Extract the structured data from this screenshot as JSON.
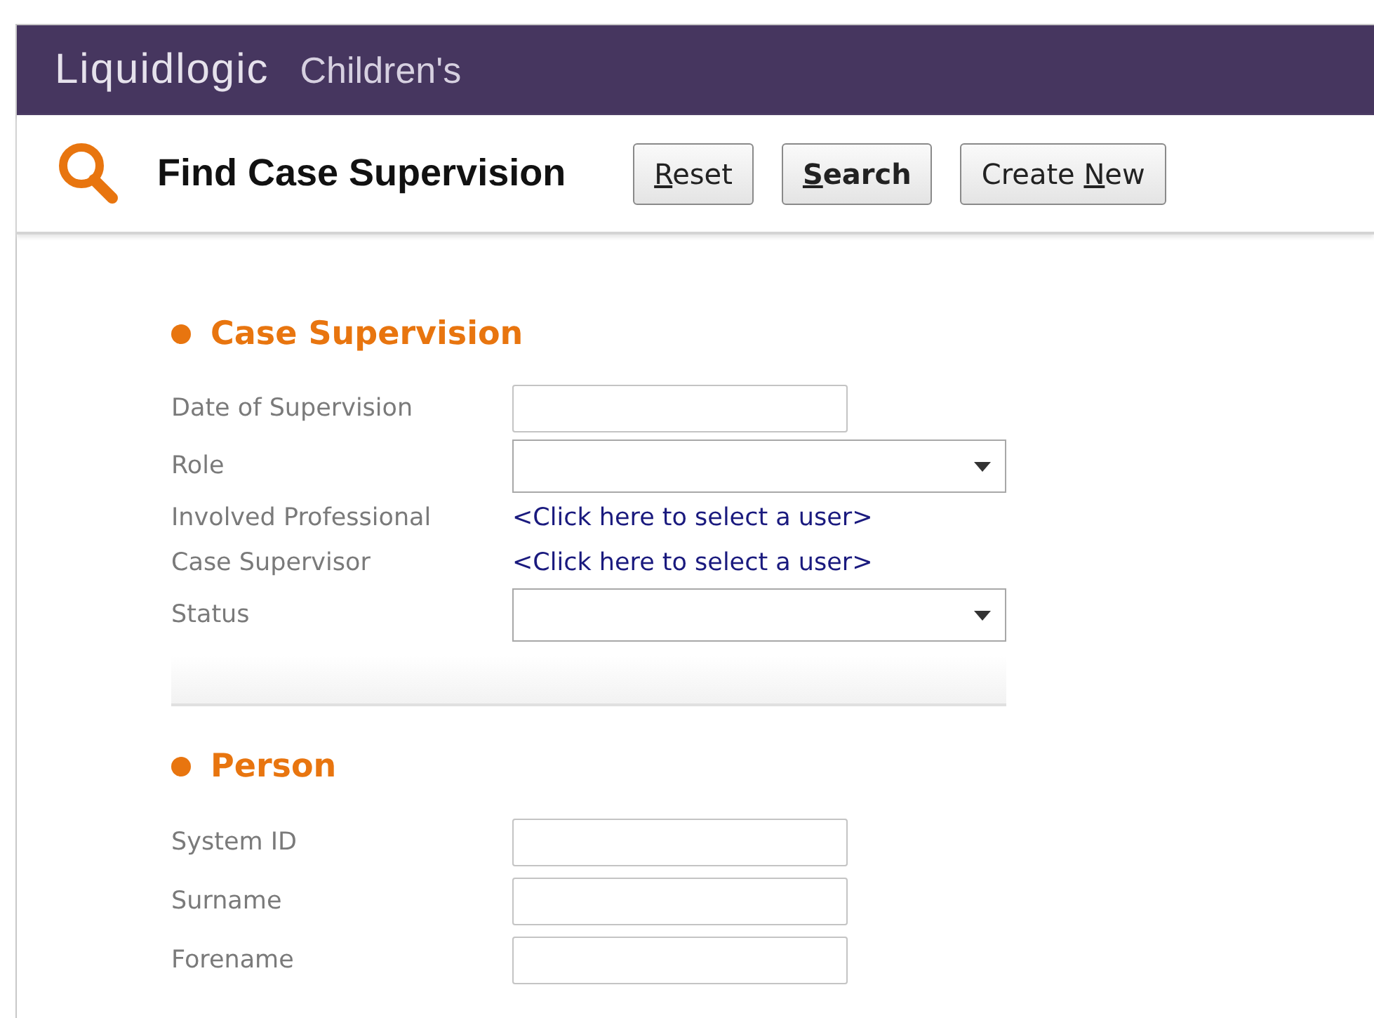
{
  "app_bar": {
    "logo": "Liquidlogic",
    "product": "Children's"
  },
  "header": {
    "title": "Find Case Supervision",
    "buttons": [
      {
        "key": "R",
        "after": "eset",
        "bold": false
      },
      {
        "key": "S",
        "after": "earch",
        "bold": true
      },
      {
        "before": "Create ",
        "key": "N",
        "after": "ew",
        "bold": false
      }
    ]
  },
  "sections": [
    {
      "title": "Case Supervision",
      "fields": [
        {
          "label": "Date of Supervision",
          "kind": "text"
        },
        {
          "label": "Role",
          "kind": "select"
        },
        {
          "label": "Involved Professional",
          "kind": "link",
          "link": "<Click here to select a user>"
        },
        {
          "label": "Case Supervisor",
          "kind": "link",
          "link": "<Click here to select a user>"
        },
        {
          "label": "Status",
          "kind": "select"
        }
      ]
    },
    {
      "title": "Person",
      "fields": [
        {
          "label": "System ID",
          "kind": "text"
        },
        {
          "label": "Surname",
          "kind": "text"
        },
        {
          "label": "Forename",
          "kind": "text"
        }
      ]
    }
  ]
}
